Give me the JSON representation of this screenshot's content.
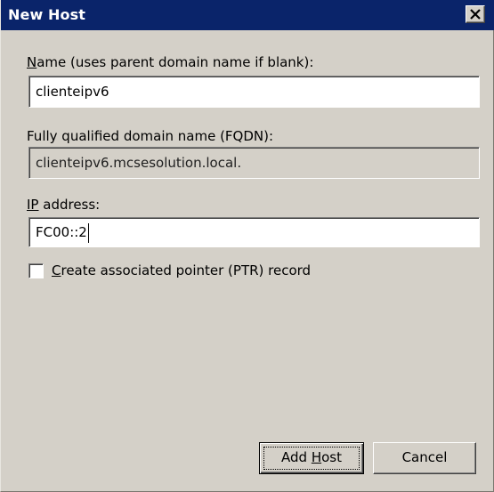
{
  "window": {
    "title": "New Host",
    "close_icon": "close-icon"
  },
  "name_field": {
    "label_underlined": "N",
    "label_rest": "ame (uses parent domain name if blank):",
    "value": "clienteipv6"
  },
  "fqdn_field": {
    "label": "Fully qualified domain name (FQDN):",
    "value": "clienteipv6.mcsesolution.local."
  },
  "ip_field": {
    "label_underlined": "IP",
    "label_rest": " address:",
    "value": "FC00::2"
  },
  "ptr_checkbox": {
    "label_underlined": "C",
    "label_rest": "reate associated pointer (PTR) record",
    "checked": false
  },
  "buttons": {
    "add_host_prefix": "Add ",
    "add_host_underlined": "H",
    "add_host_rest": "ost",
    "cancel": "Cancel"
  }
}
